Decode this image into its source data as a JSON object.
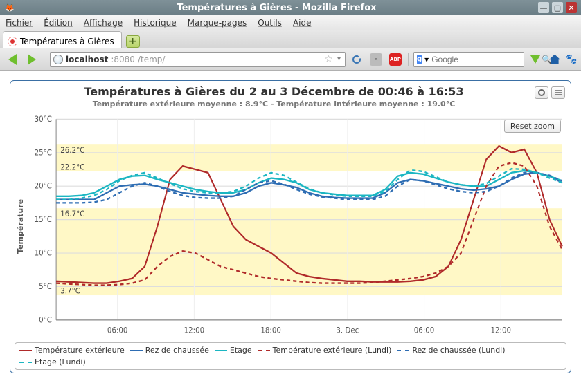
{
  "window": {
    "title": "Températures à Gières - Mozilla Firefox"
  },
  "menu": {
    "items": [
      "Fichier",
      "Édition",
      "Affichage",
      "Historique",
      "Marque-pages",
      "Outils",
      "Aide"
    ]
  },
  "tab": {
    "label": "Températures à Gières"
  },
  "url": {
    "host": "localhost",
    "port": ":8080",
    "path": "/temp/"
  },
  "search": {
    "engine": "Google",
    "placeholder": "Google"
  },
  "chart_data": {
    "type": "line",
    "title": "Températures à Gières du 2 au 3 Décembre de 00:46 à 16:53",
    "subtitle": "Température extérieure moyenne : 8.9°C - Température intérieure moyenne : 19.0°C",
    "ylabel": "Température",
    "ylim": [
      0,
      30
    ],
    "yticks": [
      "0°C",
      "5°C",
      "10°C",
      "15°C",
      "20°C",
      "25°C",
      "30°C"
    ],
    "xticks": [
      "06:00",
      "12:00",
      "18:00",
      "3. Dec",
      "06:00",
      "12:00"
    ],
    "reset_label": "Reset zoom",
    "plot_bands": [
      {
        "from": 22.2,
        "to": 26.2,
        "label_low": "22.2°C",
        "label_high": "26.2°C",
        "color": "#fff8c6"
      },
      {
        "from": 3.7,
        "to": 16.7,
        "label_low": "3.7°C",
        "label_high": "16.7°C",
        "color": "#fff8c6"
      }
    ],
    "series": [
      {
        "name": "Température extérieure",
        "color": "#b02a2a",
        "dash": false,
        "values": [
          5.8,
          5.7,
          5.6,
          5.5,
          5.5,
          5.8,
          6.2,
          8,
          14,
          21,
          23,
          22.5,
          22,
          18,
          14,
          12,
          11,
          10,
          8.5,
          7,
          6.5,
          6.2,
          6,
          5.8,
          5.8,
          5.7,
          5.7,
          5.7,
          5.8,
          6,
          6.5,
          8,
          12,
          18,
          24,
          26,
          25,
          25.5,
          22,
          15,
          11
        ]
      },
      {
        "name": "Rez de chaussée",
        "color": "#2e6db3",
        "dash": false,
        "values": [
          18,
          18,
          18,
          18,
          19,
          20,
          20.2,
          20.3,
          20,
          19.5,
          19,
          18.8,
          18.6,
          18.5,
          18.5,
          19,
          20,
          20.5,
          20.2,
          19.8,
          19,
          18.5,
          18.3,
          18.2,
          18.2,
          18.2,
          19,
          20.5,
          21,
          20.8,
          20.4,
          20,
          19.6,
          19.4,
          19.6,
          20,
          21,
          21.8,
          22,
          21.5,
          20.5
        ]
      },
      {
        "name": "Etage",
        "color": "#1bb6c2",
        "dash": false,
        "values": [
          18.5,
          18.5,
          18.6,
          19,
          20,
          21,
          21.5,
          21.6,
          21,
          20.5,
          20,
          19.5,
          19.2,
          19,
          19,
          19.5,
          20.5,
          21.2,
          21,
          20.5,
          19.5,
          19,
          18.8,
          18.6,
          18.6,
          18.6,
          19.5,
          21.5,
          22,
          21.8,
          21.2,
          20.6,
          20.2,
          20,
          20,
          21,
          22,
          22.3,
          22,
          21.5,
          20.8
        ]
      },
      {
        "name": "Température extérieure (Lundi)",
        "color": "#b02a2a",
        "dash": true,
        "values": [
          5.5,
          5.4,
          5.3,
          5.2,
          5.2,
          5.3,
          5.5,
          6,
          8,
          9.5,
          10.3,
          10,
          9,
          8,
          7.5,
          7,
          6.5,
          6.2,
          6,
          5.8,
          5.6,
          5.5,
          5.5,
          5.5,
          5.5,
          5.6,
          5.8,
          6,
          6.2,
          6.5,
          7,
          8,
          10,
          15,
          20,
          23,
          23.5,
          23,
          20,
          14,
          10.5
        ]
      },
      {
        "name": "Rez de chaussée (Lundi)",
        "color": "#2e6db3",
        "dash": true,
        "values": [
          17.5,
          17.5,
          17.5,
          17.6,
          18,
          19,
          20,
          20.5,
          20,
          19.2,
          18.6,
          18.3,
          18.2,
          18.2,
          18.5,
          19.5,
          20.5,
          20.8,
          20.3,
          19.5,
          18.8,
          18.4,
          18.2,
          18,
          18,
          18,
          18.5,
          20,
          21,
          20.8,
          20.2,
          19.6,
          19.2,
          19,
          19.2,
          20,
          21.2,
          22,
          22,
          21.6,
          20.8
        ]
      },
      {
        "name": "Etage (Lundi)",
        "color": "#1bb6c2",
        "dash": true,
        "values": [
          18,
          18,
          18.2,
          18.6,
          19.5,
          20.8,
          21.6,
          22,
          21.2,
          20.4,
          19.6,
          19.2,
          19,
          19,
          19.2,
          20,
          21.2,
          22,
          21.6,
          20.6,
          19.6,
          19,
          18.7,
          18.5,
          18.5,
          18.5,
          19.2,
          21,
          22.4,
          22.2,
          21.4,
          20.6,
          20.2,
          20,
          20.4,
          21.5,
          22.6,
          22.5,
          22,
          21.2,
          20.5
        ]
      }
    ]
  }
}
